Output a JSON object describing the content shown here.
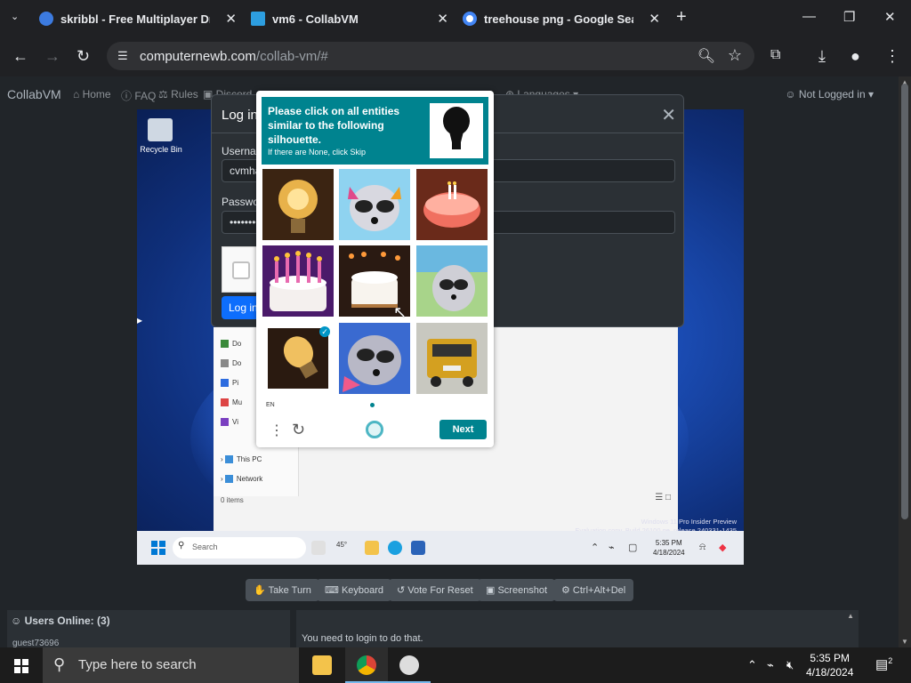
{
  "browser": {
    "tabs": [
      {
        "title": "skribbl - Free Multiplayer Drawing",
        "favicon_color": "#3c7be0"
      },
      {
        "title": "vm6 - CollabVM",
        "favicon_color": "#2d9ee0"
      },
      {
        "title": "treehouse png - Google Search",
        "favicon_color": "#4285f4"
      }
    ],
    "url_host": "computernewb.com",
    "url_path": "/collab-vm/#"
  },
  "navbar": {
    "brand": "CollabVM",
    "items": [
      "Home",
      "FAQ",
      "Rules",
      "Discord",
      "Languages"
    ],
    "user": "Not Logged in"
  },
  "vm": {
    "recycle_label": "Recycle Bin",
    "explorer": {
      "items": [
        "Do",
        "Do",
        "Pi",
        "Mu",
        "Vi",
        "This PC",
        "Network"
      ],
      "status": "0 items"
    },
    "watermark": [
      "Windows 11 Pro Insider Preview",
      "Evaluation copy. Build 26100.ge_release.240331-1435"
    ],
    "taskbar": {
      "search": "Search",
      "temp": "45°",
      "time": "5:35 PM",
      "date": "4/18/2024"
    }
  },
  "login": {
    "title": "Log in",
    "username_label": "Username",
    "username_value": "cvmha",
    "password_label": "Password",
    "password_value": "••••••••",
    "button": "Log in"
  },
  "hcaptcha": {
    "prompt": "Please click on all entities similar to the following silhouette.",
    "sub": "If there are None, click Skip",
    "lang": "EN",
    "next": "Next",
    "cells": [
      {
        "subject": "light bulb",
        "selected": false
      },
      {
        "subject": "raccoon",
        "selected": false
      },
      {
        "subject": "birthday cake",
        "selected": false
      },
      {
        "subject": "birthday cake with candles",
        "selected": false
      },
      {
        "subject": "birthday cake",
        "selected": false
      },
      {
        "subject": "raccoon",
        "selected": false
      },
      {
        "subject": "light bulb",
        "selected": true
      },
      {
        "subject": "raccoon",
        "selected": false
      },
      {
        "subject": "school bus",
        "selected": false
      }
    ]
  },
  "controls": {
    "buttons": [
      "Take Turn",
      "Keyboard",
      "Vote For Reset",
      "Screenshot",
      "Ctrl+Alt+Del"
    ]
  },
  "users": {
    "header": "Users Online: (3)",
    "first": "guest73696"
  },
  "chat": {
    "message": "You need to login to do that."
  },
  "taskbar": {
    "search_placeholder": "Type here to search",
    "time": "5:35 PM",
    "date": "4/18/2024",
    "notifications": "2"
  }
}
